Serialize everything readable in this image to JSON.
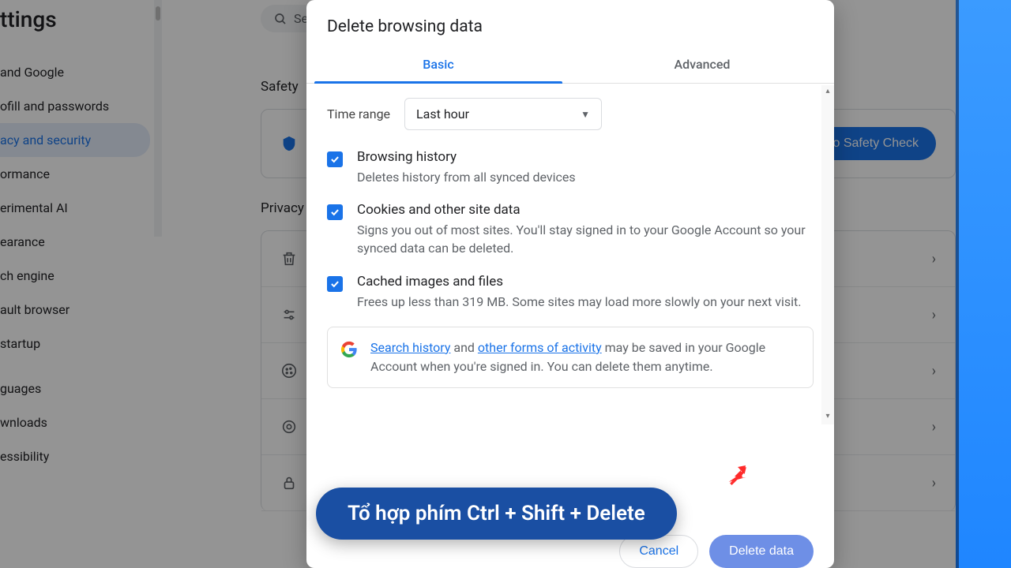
{
  "bg": {
    "title_fragment": "ttings",
    "search_fragment": "Se",
    "sidebar": [
      {
        "label": "and Google",
        "selected": false
      },
      {
        "label": "ofill and passwords",
        "selected": false
      },
      {
        "label": "acy and security",
        "selected": true
      },
      {
        "label": "ormance",
        "selected": false
      },
      {
        "label": "erimental AI",
        "selected": false
      },
      {
        "label": "earance",
        "selected": false
      },
      {
        "label": "ch engine",
        "selected": false
      },
      {
        "label": "ault browser",
        "selected": false
      },
      {
        "label": "startup",
        "selected": false
      },
      {
        "label": "guages",
        "selected": false
      },
      {
        "label": "wnloads",
        "selected": false
      },
      {
        "label": "essibility",
        "selected": false
      }
    ],
    "section1": "Safety",
    "safety_button": "to Safety Check",
    "section2": "Privacy"
  },
  "modal": {
    "title": "Delete browsing data",
    "tabs": {
      "basic": "Basic",
      "advanced": "Advanced",
      "active": "basic"
    },
    "time_label": "Time range",
    "time_value": "Last hour",
    "options": [
      {
        "checked": true,
        "title": "Browsing history",
        "desc": "Deletes history from all synced devices"
      },
      {
        "checked": true,
        "title": "Cookies and other site data",
        "desc": "Signs you out of most sites. You'll stay signed in to your Google Account so your synced data can be deleted."
      },
      {
        "checked": true,
        "title": "Cached images and files",
        "desc": "Frees up less than 319 MB. Some sites may load more slowly on your next visit."
      }
    ],
    "info": {
      "link1": "Search history",
      "mid1": " and ",
      "link2": "other forms of activity",
      "rest": " may be saved in your Google Account when you're signed in. You can delete them anytime."
    },
    "cancel": "Cancel",
    "delete": "Delete data"
  },
  "pill": "Tổ hợp phím Ctrl + Shift + Delete"
}
